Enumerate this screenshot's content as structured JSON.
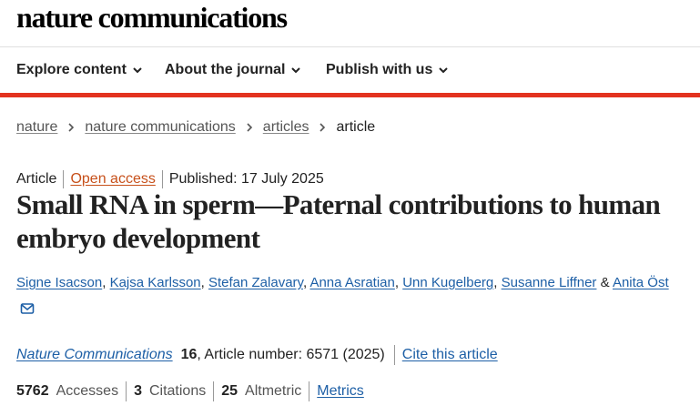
{
  "site": {
    "logo": "nature communications"
  },
  "nav": {
    "items": [
      {
        "label": "Explore content"
      },
      {
        "label": "About the journal"
      },
      {
        "label": "Publish with us"
      }
    ]
  },
  "breadcrumb": {
    "items": [
      "nature",
      "nature communications",
      "articles"
    ],
    "current": "article"
  },
  "article": {
    "type": "Article",
    "access": "Open access",
    "published": "Published: 17 July 2025",
    "title": "Small RNA in sperm—Paternal contributions to human embryo development",
    "authors": [
      "Signe Isacson",
      "Kajsa Karlsson",
      "Stefan Zalavary",
      "Anna Asratian",
      "Unn Kugelberg",
      "Susanne Liffner",
      "Anita Öst"
    ],
    "author_sep": ", ",
    "author_last_sep": " & "
  },
  "citation": {
    "journal": "Nature Communications",
    "volume": "16",
    "article_number": ", Article number: 6571 (2025)",
    "cite_label": "Cite this article"
  },
  "metrics": {
    "accesses_value": "5762",
    "accesses_label": "Accesses",
    "citations_value": "3",
    "citations_label": "Citations",
    "altmetric_value": "25",
    "altmetric_label": "Altmetric",
    "metrics_link": "Metrics"
  },
  "colors": {
    "accent_red": "#e3331f",
    "link_blue": "#1d5fa6",
    "open_access_orange": "#c7501a"
  },
  "icons": {
    "nav_chevron": "chevron-down-icon",
    "breadcrumb_sep": "chevron-right-icon",
    "email": "email-icon"
  }
}
